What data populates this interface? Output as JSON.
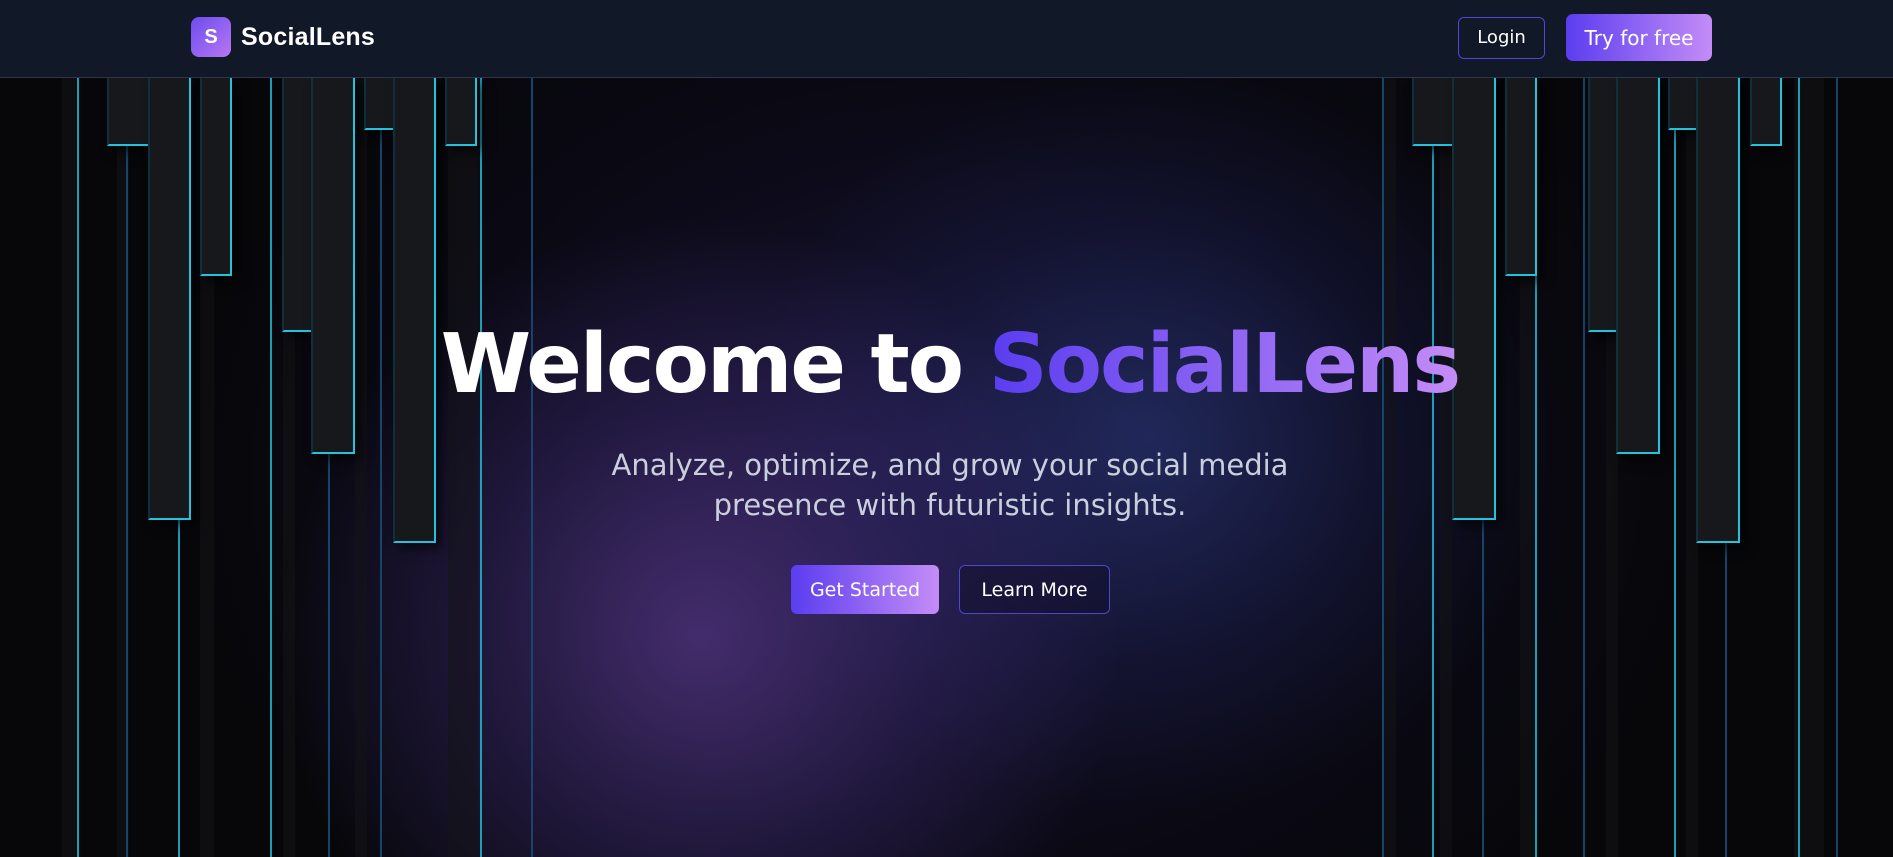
{
  "navbar": {
    "logo_letter": "S",
    "brand_name": "SocialLens",
    "login_label": "Login",
    "try_label": "Try for free"
  },
  "hero": {
    "title_prefix": "Welcome to ",
    "title_accent": "SocialLens",
    "subtitle": "Analyze, optimize, and grow your social media presence with futuristic insights.",
    "primary_button": "Get Started",
    "secondary_button": "Learn More"
  },
  "colors": {
    "navbar_bg": "#111827",
    "accent_start": "#5b3df0",
    "accent_end": "#c48cf7",
    "cyan_line": "#22c3dc"
  }
}
